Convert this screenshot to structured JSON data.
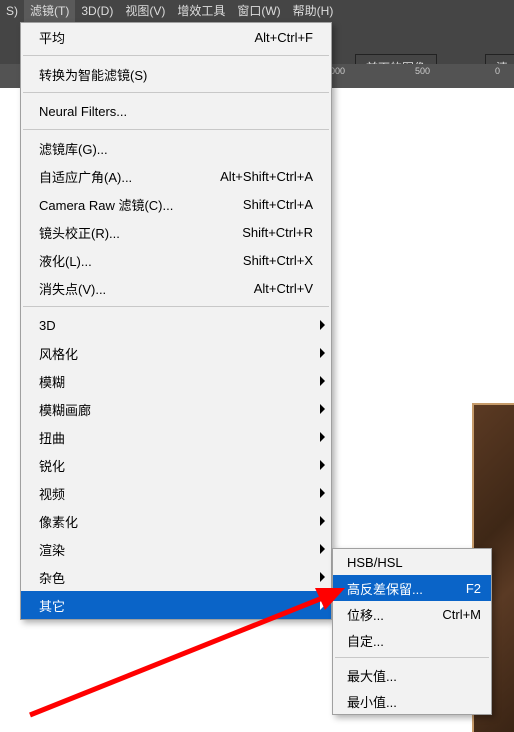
{
  "menubar": {
    "items": [
      "S)",
      "滤镜(T)",
      "3D(D)",
      "视图(V)",
      "增效工具",
      "窗口(W)",
      "帮助(H)"
    ]
  },
  "toolbar": {
    "btn_prev_image": "前面的图像",
    "btn_clear": "清除"
  },
  "ruler_ticks": [
    "000",
    "500",
    "0"
  ],
  "menu": {
    "recent_label": "平均",
    "recent_shortcut": "Alt+Ctrl+F",
    "convert_smart": "转换为智能滤镜(S)",
    "neural": "Neural Filters...",
    "filter_gallery": "滤镜库(G)...",
    "adaptive_wide": {
      "label": "自适应广角(A)...",
      "sc": "Alt+Shift+Ctrl+A"
    },
    "camera_raw": {
      "label": "Camera Raw 滤镜(C)...",
      "sc": "Shift+Ctrl+A"
    },
    "lens_corr": {
      "label": "镜头校正(R)...",
      "sc": "Shift+Ctrl+R"
    },
    "liquify": {
      "label": "液化(L)...",
      "sc": "Shift+Ctrl+X"
    },
    "vanishing": {
      "label": "消失点(V)...",
      "sc": "Alt+Ctrl+V"
    },
    "groups": [
      "3D",
      "风格化",
      "模糊",
      "模糊画廊",
      "扭曲",
      "锐化",
      "视频",
      "像素化",
      "渲染",
      "杂色",
      "其它"
    ]
  },
  "submenu": {
    "items": [
      {
        "label": "HSB/HSL",
        "sc": ""
      },
      {
        "label": "高反差保留...",
        "sc": "F2",
        "hl": true
      },
      {
        "label": "位移...",
        "sc": "Ctrl+M"
      },
      {
        "label": "自定...",
        "sc": ""
      },
      {
        "label": "最大值...",
        "sc": "",
        "sep_before": true
      },
      {
        "label": "最小值...",
        "sc": ""
      }
    ]
  }
}
